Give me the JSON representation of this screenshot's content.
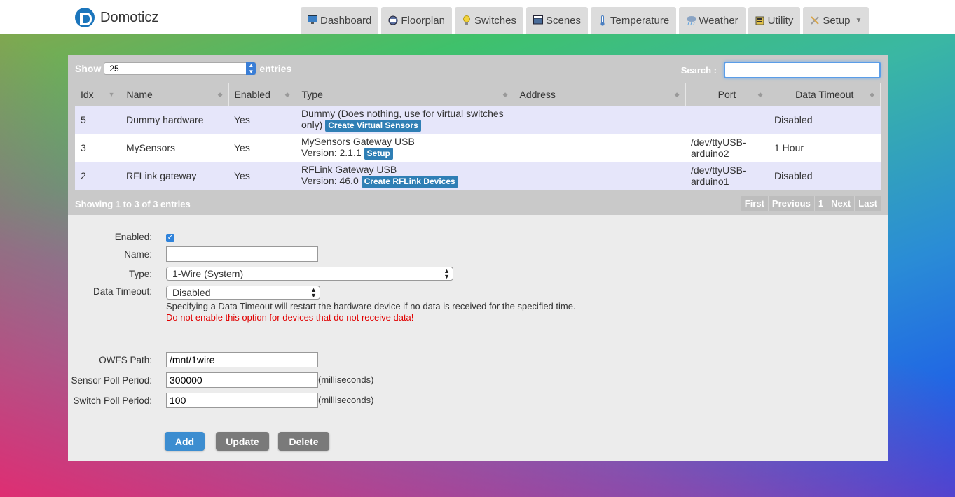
{
  "brand": {
    "name": "Domoticz"
  },
  "nav": [
    {
      "label": "Dashboard",
      "icon": "monitor-icon"
    },
    {
      "label": "Floorplan",
      "icon": "floorplan-icon"
    },
    {
      "label": "Switches",
      "icon": "lightbulb-icon"
    },
    {
      "label": "Scenes",
      "icon": "clapper-icon"
    },
    {
      "label": "Temperature",
      "icon": "thermometer-icon"
    },
    {
      "label": "Weather",
      "icon": "rain-cloud-icon"
    },
    {
      "label": "Utility",
      "icon": "utility-icon"
    },
    {
      "label": "Setup",
      "icon": "tools-icon"
    }
  ],
  "table": {
    "show_label": "Show",
    "show_value": "25",
    "entries_label": "entries",
    "search_label": "Search :",
    "search_value": "",
    "columns": [
      "Idx",
      "Name",
      "Enabled",
      "Type",
      "Address",
      "Port",
      "Data Timeout"
    ],
    "rows": [
      {
        "idx": "5",
        "name": "Dummy hardware",
        "enabled": "Yes",
        "type_line1": "Dummy (Does nothing, use for virtual switches",
        "type_line2": "only)",
        "action": "Create Virtual Sensors",
        "address": "",
        "port_line1": "",
        "port_line2": "",
        "timeout": "Disabled"
      },
      {
        "idx": "3",
        "name": "MySensors",
        "enabled": "Yes",
        "type_line1": "MySensors Gateway USB",
        "type_line2": "Version: 2.1.1",
        "action": "Setup",
        "address": "",
        "port_line1": "/dev/ttyUSB-",
        "port_line2": "arduino2",
        "timeout": "1 Hour"
      },
      {
        "idx": "2",
        "name": "RFLink gateway",
        "enabled": "Yes",
        "type_line1": "RFLink Gateway USB",
        "type_line2": "Version: 46.0",
        "action": "Create RFLink Devices",
        "address": "",
        "port_line1": "/dev/ttyUSB-",
        "port_line2": "arduino1",
        "timeout": "Disabled"
      }
    ],
    "info": "Showing 1 to 3 of 3 entries",
    "pager": [
      "First",
      "Previous",
      "1",
      "Next",
      "Last"
    ]
  },
  "form": {
    "enabled_label": "Enabled:",
    "name_label": "Name:",
    "name_value": "",
    "type_label": "Type:",
    "type_value": "1-Wire (System)",
    "timeout_label": "Data Timeout:",
    "timeout_value": "Disabled",
    "timeout_note": "Specifying a Data Timeout will restart the hardware device if no data is received for the specified time.",
    "timeout_warning": "Do not enable this option for devices that do not receive data!",
    "owfs_label": "OWFS Path:",
    "owfs_value": "/mnt/1wire",
    "sensor_poll_label": "Sensor Poll Period:",
    "sensor_poll_value": "300000",
    "switch_poll_label": "Switch Poll Period:",
    "switch_poll_value": "100",
    "unit": "(milliseconds)",
    "add_label": "Add",
    "update_label": "Update",
    "delete_label": "Delete"
  },
  "colors": {
    "accent": "#2f7fb5",
    "warning": "#e00000",
    "row_highlight": "#e6e6fa"
  }
}
